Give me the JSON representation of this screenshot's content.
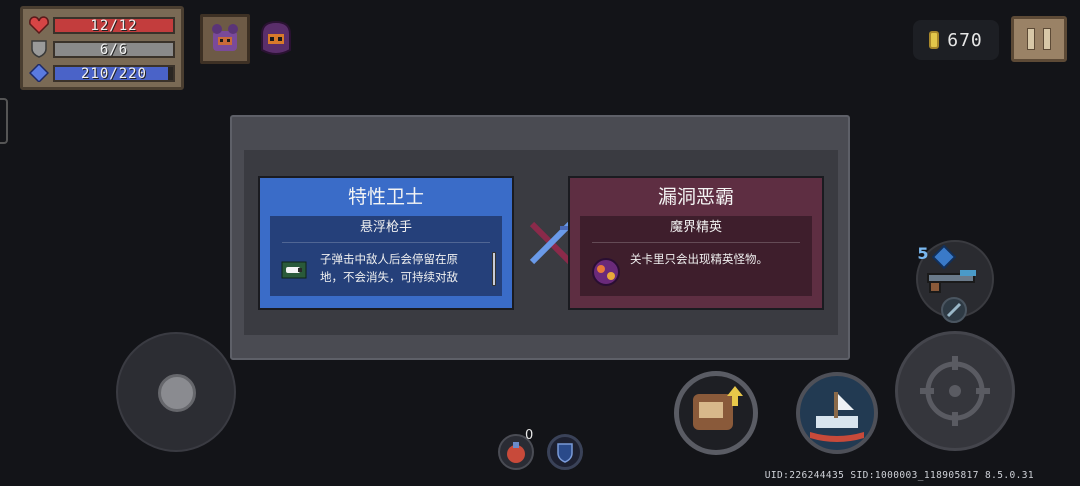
{
  "hud": {
    "hp": "12/12",
    "armor": "6/6",
    "energy": "210/220",
    "hp_fraction": 1.0,
    "armor_fraction": 1.0,
    "energy_fraction": 0.9545,
    "colors": {
      "hp": "#c33d3d",
      "armor": "#8a8a8a",
      "energy": "#4a63c8"
    },
    "coins": "670"
  },
  "modal": {
    "left_card": {
      "title": "特性卫士",
      "subtitle": "悬浮枪手",
      "desc_line1": "子弹击中敌人后会停留在原",
      "desc_line2": "地，不会消失，可持续对敌",
      "color": "#3a6cc8"
    },
    "right_card": {
      "title": "漏洞恶霸",
      "subtitle": "魔界精英",
      "desc_line1": "关卡里只会出现精英怪物。",
      "color": "#5e2e42"
    }
  },
  "weapon": {
    "energy_cost": "5"
  },
  "items": {
    "slot1_count": "0"
  },
  "footer": {
    "uid": "UID:226244435 SID:1000003_118905817 8.5.0.31"
  },
  "icons": {
    "hp": "heart-icon",
    "armor": "shield-icon",
    "energy": "diamond-icon",
    "coin": "coin-icon",
    "pause": "pause-icon",
    "versus": "crossed-swords-icon"
  }
}
